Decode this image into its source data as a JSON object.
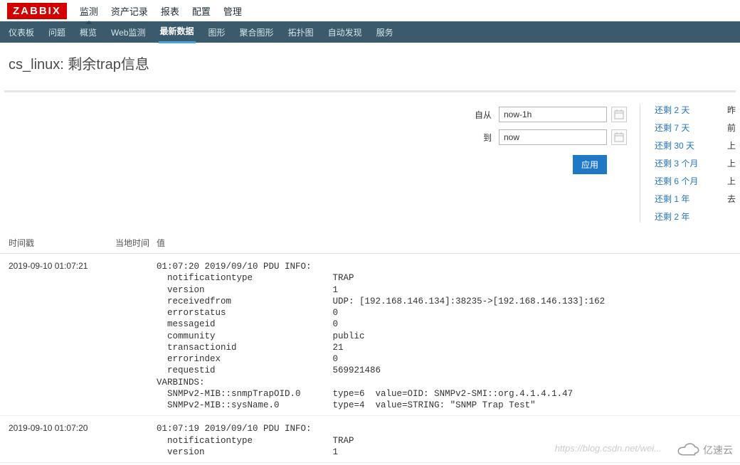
{
  "logo": "ZABBIX",
  "topnav": [
    "监测",
    "资产记录",
    "报表",
    "配置",
    "管理"
  ],
  "topnav_active": 0,
  "subnav": [
    "仪表板",
    "问题",
    "概览",
    "Web监测",
    "最新数据",
    "图形",
    "聚合图形",
    "拓扑图",
    "自动发现",
    "服务"
  ],
  "subnav_active": 4,
  "page_title": "cs_linux: 剩余trap信息",
  "filter": {
    "from_label": "自从",
    "from_value": "now-1h",
    "to_label": "到",
    "to_value": "now",
    "apply_label": "应用"
  },
  "quick_links": [
    "还剩 2 天",
    "还剩 7 天",
    "还剩 30 天",
    "还剩 3 个月",
    "还剩 6 个月",
    "还剩 1 年",
    "还剩 2 年"
  ],
  "right_links": [
    "昨",
    "前",
    "上",
    "上",
    "上",
    "去"
  ],
  "columns": {
    "timestamp": "时间戳",
    "localtime": "当地时间",
    "value": "值"
  },
  "rows": [
    {
      "timestamp": "2019-09-10 01:07:21",
      "value": "01:07:20 2019/09/10 PDU INFO:\n  notificationtype               TRAP\n  version                        1\n  receivedfrom                   UDP: [192.168.146.134]:38235->[192.168.146.133]:162\n  errorstatus                    0\n  messageid                      0\n  community                      public\n  transactionid                  21\n  errorindex                     0\n  requestid                      569921486\nVARBINDS:\n  SNMPv2-MIB::snmpTrapOID.0      type=6  value=OID: SNMPv2-SMI::org.4.1.4.1.47\n  SNMPv2-MIB::sysName.0          type=4  value=STRING: \"SNMP Trap Test\""
    },
    {
      "timestamp": "2019-09-10 01:07:20",
      "value": "01:07:19 2019/09/10 PDU INFO:\n  notificationtype               TRAP\n  version                        1"
    }
  ],
  "watermark": "https://blog.csdn.net/wei...",
  "brand": "亿速云"
}
